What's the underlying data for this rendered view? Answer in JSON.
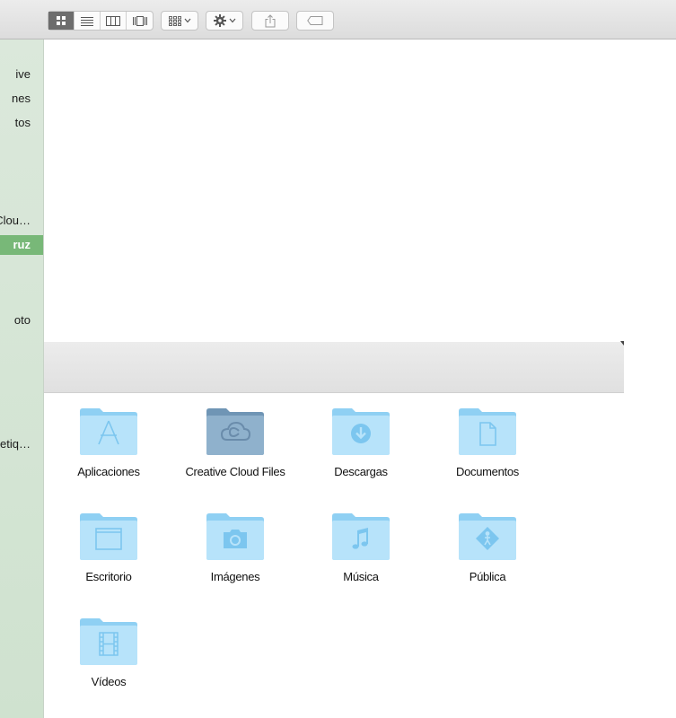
{
  "toolbar": {
    "view_buttons": [
      {
        "name": "icon-view",
        "icon": "grid-icon",
        "active": true
      },
      {
        "name": "list-view",
        "icon": "list-icon",
        "active": false
      },
      {
        "name": "column-view",
        "icon": "columns-icon",
        "active": false
      },
      {
        "name": "coverflow-view",
        "icon": "coverflow-icon",
        "active": false
      }
    ],
    "arrange_icon": "arrange-grid-icon",
    "action_icon": "gear-icon",
    "share_icon": "share-icon",
    "tag_icon": "tag-icon"
  },
  "sidebar": {
    "items": [
      {
        "label": "ive"
      },
      {
        "label": "nes"
      },
      {
        "label": "tos"
      },
      {
        "label": "Clou…"
      },
      {
        "label": "ruz",
        "selected": true
      },
      {
        "label": "oto"
      },
      {
        "label": "etiq…"
      }
    ],
    "selected_color": "#78b878"
  },
  "folders": [
    {
      "label": "Aplicaciones",
      "glyph": "apps-icon"
    },
    {
      "label": "Creative Cloud Files",
      "glyph": "creative-cloud-icon"
    },
    {
      "label": "Descargas",
      "glyph": "download-icon"
    },
    {
      "label": "Documentos",
      "glyph": "document-icon"
    },
    {
      "label": "Escritorio",
      "glyph": "desktop-icon"
    },
    {
      "label": "Imágenes",
      "glyph": "camera-icon"
    },
    {
      "label": "Música",
      "glyph": "music-icon"
    },
    {
      "label": "Pública",
      "glyph": "public-icon"
    },
    {
      "label": "Vídeos",
      "glyph": "film-icon"
    }
  ],
  "colors": {
    "folder_light": "#b7e3fa",
    "folder_dark": "#7cc6ef",
    "cc_folder": "#8fb1cc"
  }
}
